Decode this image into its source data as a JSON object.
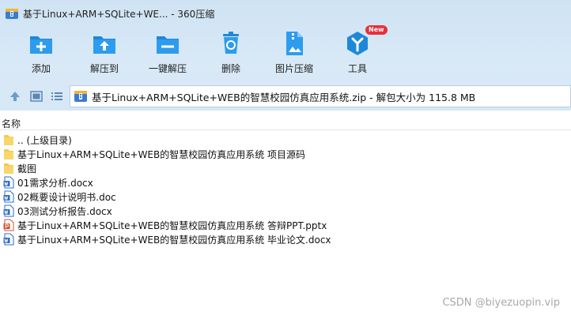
{
  "window": {
    "title": "基于Linux+ARM+SQLite+WE... - 360压缩"
  },
  "toolbar": {
    "items": [
      {
        "label": "添加",
        "icon": "add-icon"
      },
      {
        "label": "解压到",
        "icon": "extract-to-icon"
      },
      {
        "label": "一键解压",
        "icon": "one-click-extract-icon"
      },
      {
        "label": "删除",
        "icon": "delete-icon"
      },
      {
        "label": "图片压缩",
        "icon": "image-compress-icon"
      },
      {
        "label": "工具",
        "icon": "tools-icon",
        "badge": "New"
      }
    ]
  },
  "path": {
    "text": "基于Linux+ARM+SQLite+WEB的智慧校园仿真应用系统.zip - 解包大小为 115.8 MB"
  },
  "list": {
    "column_name": "名称",
    "items": [
      {
        "name": ".. (上级目录)",
        "type": "folder"
      },
      {
        "name": "基于Linux+ARM+SQLite+WEB的智慧校园仿真应用系统  项目源码",
        "type": "folder"
      },
      {
        "name": "截图",
        "type": "folder"
      },
      {
        "name": "01需求分析.docx",
        "type": "docx"
      },
      {
        "name": "02概要设计说明书.doc",
        "type": "docx"
      },
      {
        "name": "03测试分析报告.docx",
        "type": "docx"
      },
      {
        "name": "基于Linux+ARM+SQLite+WEB的智慧校园仿真应用系统  答辩PPT.pptx",
        "type": "pptx"
      },
      {
        "name": "基于Linux+ARM+SQLite+WEB的智慧校园仿真应用系统 毕业论文.docx",
        "type": "docx"
      }
    ]
  },
  "watermark": "CSDN @biyezuopin.vip",
  "colors": {
    "toolbar_bg": "#d6e7f5",
    "icon_blue": "#1e88d8",
    "folder_yellow": "#f5c94c",
    "word_blue": "#2b6cc4",
    "ppt_orange": "#d2512b",
    "badge_red": "#e8303a"
  }
}
